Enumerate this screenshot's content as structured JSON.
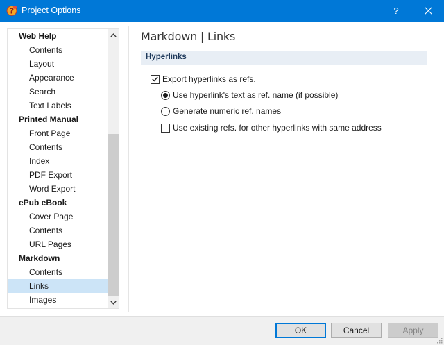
{
  "window": {
    "title": "Project Options",
    "help_label": "?"
  },
  "nav": {
    "items": [
      {
        "label": "Web Help",
        "type": "group"
      },
      {
        "label": "Contents",
        "type": "child"
      },
      {
        "label": "Layout",
        "type": "child"
      },
      {
        "label": "Appearance",
        "type": "child"
      },
      {
        "label": "Search",
        "type": "child"
      },
      {
        "label": "Text Labels",
        "type": "child"
      },
      {
        "label": "Printed Manual",
        "type": "group"
      },
      {
        "label": "Front Page",
        "type": "child"
      },
      {
        "label": "Contents",
        "type": "child"
      },
      {
        "label": "Index",
        "type": "child"
      },
      {
        "label": "PDF Export",
        "type": "child"
      },
      {
        "label": "Word Export",
        "type": "child"
      },
      {
        "label": "ePub eBook",
        "type": "group"
      },
      {
        "label": "Cover Page",
        "type": "child"
      },
      {
        "label": "Contents",
        "type": "child"
      },
      {
        "label": "URL Pages",
        "type": "child"
      },
      {
        "label": "Markdown",
        "type": "group"
      },
      {
        "label": "Contents",
        "type": "child"
      },
      {
        "label": "Links",
        "type": "child",
        "selected": true
      },
      {
        "label": "Images",
        "type": "child"
      }
    ]
  },
  "content": {
    "page_title": "Markdown | Links",
    "section_title": "Hyperlinks",
    "export_refs": {
      "label": "Export hyperlinks as refs.",
      "checked": true
    },
    "use_text": {
      "label": "Use hyperlink's text as ref. name (if possible)",
      "selected": true
    },
    "numeric": {
      "label": "Generate numeric ref. names",
      "selected": false
    },
    "use_existing": {
      "label": "Use existing refs. for other hyperlinks with same address",
      "checked": false
    }
  },
  "buttons": {
    "ok": "OK",
    "cancel": "Cancel",
    "apply": "Apply"
  },
  "colors": {
    "titlebar": "#0078d7",
    "selection": "#cce4f7",
    "section_bg": "#e8eef5",
    "section_text": "#1e395b"
  }
}
